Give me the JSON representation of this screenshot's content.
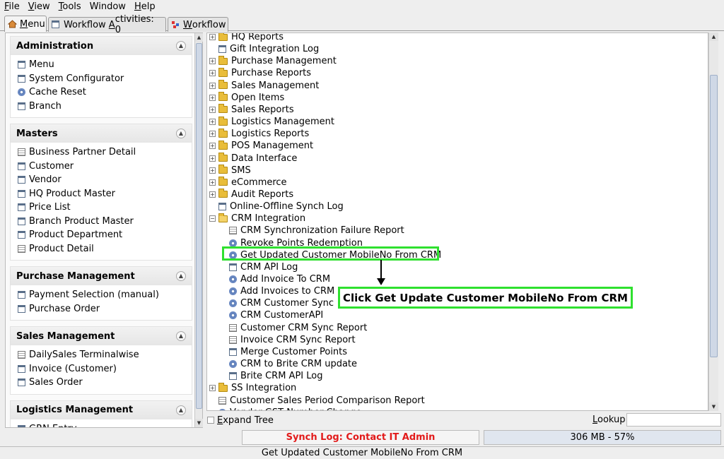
{
  "menubar": [
    {
      "pre": "",
      "u": "F",
      "post": "ile"
    },
    {
      "pre": "",
      "u": "V",
      "post": "iew"
    },
    {
      "pre": "",
      "u": "T",
      "post": "ools"
    },
    {
      "pre": "",
      "u": "",
      "post": "Window"
    },
    {
      "pre": "",
      "u": "H",
      "post": "elp"
    }
  ],
  "tabs": {
    "menu": {
      "u": "M",
      "post": "enu"
    },
    "workflow_activities": {
      "pre": "Workflow ",
      "u": "A",
      "post": "ctivities: 0"
    },
    "workflow": {
      "u": "W",
      "post": "orkflow"
    }
  },
  "sidebar": {
    "sections": [
      {
        "title": "Administration",
        "items": [
          {
            "label": "Menu",
            "icon": "window-icon"
          },
          {
            "label": "System Configurator",
            "icon": "window-icon"
          },
          {
            "label": "Cache Reset",
            "icon": "process-gear-icon"
          },
          {
            "label": "Branch",
            "icon": "window-icon"
          }
        ]
      },
      {
        "title": "Masters",
        "items": [
          {
            "label": "Business Partner Detail",
            "icon": "report-icon"
          },
          {
            "label": "Customer",
            "icon": "window-icon"
          },
          {
            "label": "Vendor",
            "icon": "window-icon"
          },
          {
            "label": "HQ Product Master",
            "icon": "window-icon"
          },
          {
            "label": "Price List",
            "icon": "window-icon"
          },
          {
            "label": "Branch Product Master",
            "icon": "window-icon"
          },
          {
            "label": "Product Department",
            "icon": "window-icon"
          },
          {
            "label": "Product Detail",
            "icon": "report-icon"
          }
        ]
      },
      {
        "title": "Purchase Management",
        "items": [
          {
            "label": "Payment Selection (manual)",
            "icon": "window-icon"
          },
          {
            "label": "Purchase Order",
            "icon": "window-icon"
          }
        ]
      },
      {
        "title": "Sales Management",
        "items": [
          {
            "label": "DailySales Terminalwise",
            "icon": "report-icon"
          },
          {
            "label": "Invoice (Customer)",
            "icon": "window-icon"
          },
          {
            "label": "Sales Order",
            "icon": "window-icon"
          }
        ]
      },
      {
        "title": "Logistics Management",
        "items": [
          {
            "label": "GRN Entry",
            "icon": "window-icon"
          }
        ]
      }
    ]
  },
  "tree": {
    "nodes": [
      {
        "label": "HQ Reports",
        "type": "folder",
        "level": 0,
        "state": "collapsed"
      },
      {
        "label": "Gift Integration Log",
        "type": "window",
        "level": 0
      },
      {
        "label": "Purchase Management",
        "type": "folder",
        "level": 0,
        "state": "collapsed"
      },
      {
        "label": "Purchase Reports",
        "type": "folder",
        "level": 0,
        "state": "collapsed"
      },
      {
        "label": "Sales Management",
        "type": "folder",
        "level": 0,
        "state": "collapsed"
      },
      {
        "label": "Open Items",
        "type": "folder",
        "level": 0,
        "state": "collapsed"
      },
      {
        "label": "Sales Reports",
        "type": "folder",
        "level": 0,
        "state": "collapsed"
      },
      {
        "label": "Logistics Management",
        "type": "folder",
        "level": 0,
        "state": "collapsed"
      },
      {
        "label": "Logistics Reports",
        "type": "folder",
        "level": 0,
        "state": "collapsed"
      },
      {
        "label": "POS Management",
        "type": "folder",
        "level": 0,
        "state": "collapsed"
      },
      {
        "label": "Data Interface",
        "type": "folder",
        "level": 0,
        "state": "collapsed"
      },
      {
        "label": "SMS",
        "type": "folder",
        "level": 0,
        "state": "collapsed"
      },
      {
        "label": "eCommerce",
        "type": "folder",
        "level": 0,
        "state": "collapsed"
      },
      {
        "label": "Audit Reports",
        "type": "folder",
        "level": 0,
        "state": "collapsed"
      },
      {
        "label": "Online-Offline Synch Log",
        "type": "window",
        "level": 0
      },
      {
        "label": "CRM Integration",
        "type": "folder",
        "level": 0,
        "state": "expanded"
      },
      {
        "label": "CRM Synchronization Failure Report",
        "type": "report",
        "level": 1
      },
      {
        "label": "Revoke Points Redemption",
        "type": "process",
        "level": 1
      },
      {
        "label": "Get Updated Customer MobileNo From CRM",
        "type": "process",
        "level": 1
      },
      {
        "label": "CRM API Log",
        "type": "window",
        "level": 1
      },
      {
        "label": "Add Invoice To CRM",
        "type": "process",
        "level": 1
      },
      {
        "label": "Add Invoices to CRM",
        "type": "process",
        "level": 1
      },
      {
        "label": "CRM Customer Sync",
        "type": "process",
        "level": 1
      },
      {
        "label": "CRM CustomerAPI",
        "type": "process",
        "level": 1
      },
      {
        "label": "Customer CRM Sync Report",
        "type": "report",
        "level": 1
      },
      {
        "label": "Invoice CRM Sync Report",
        "type": "report",
        "level": 1
      },
      {
        "label": "Merge Customer Points",
        "type": "window",
        "level": 1
      },
      {
        "label": "CRM to Brite CRM update",
        "type": "process",
        "level": 1
      },
      {
        "label": "Brite CRM API Log",
        "type": "window",
        "level": 1
      },
      {
        "label": "SS Integration",
        "type": "folder",
        "level": 0,
        "state": "collapsed"
      },
      {
        "label": "Customer Sales Period Comparison Report",
        "type": "report",
        "level": 0
      },
      {
        "label": "Vendor GST Number Change",
        "type": "process",
        "level": 0
      }
    ]
  },
  "annotation": {
    "callout_text": "Click Get Update Customer MobileNo From CRM",
    "highlight_color": "#2fe02f"
  },
  "bottom": {
    "expand_tree": {
      "u": "E",
      "post": "xpand Tree"
    },
    "lookup": {
      "u": "L",
      "post": "ookup"
    },
    "lookup_value": "",
    "synch_log": "Synch Log: Contact IT Admin",
    "memory_text": "306 MB - 57%",
    "memory_fraction": 0.57
  },
  "statusbar": {
    "text": "Get Updated Customer MobileNo From CRM"
  },
  "colors": {
    "synch_log_text": "#e21a1a",
    "highlight": "#2fe02f",
    "memory_bar": "#e0e6ef"
  }
}
